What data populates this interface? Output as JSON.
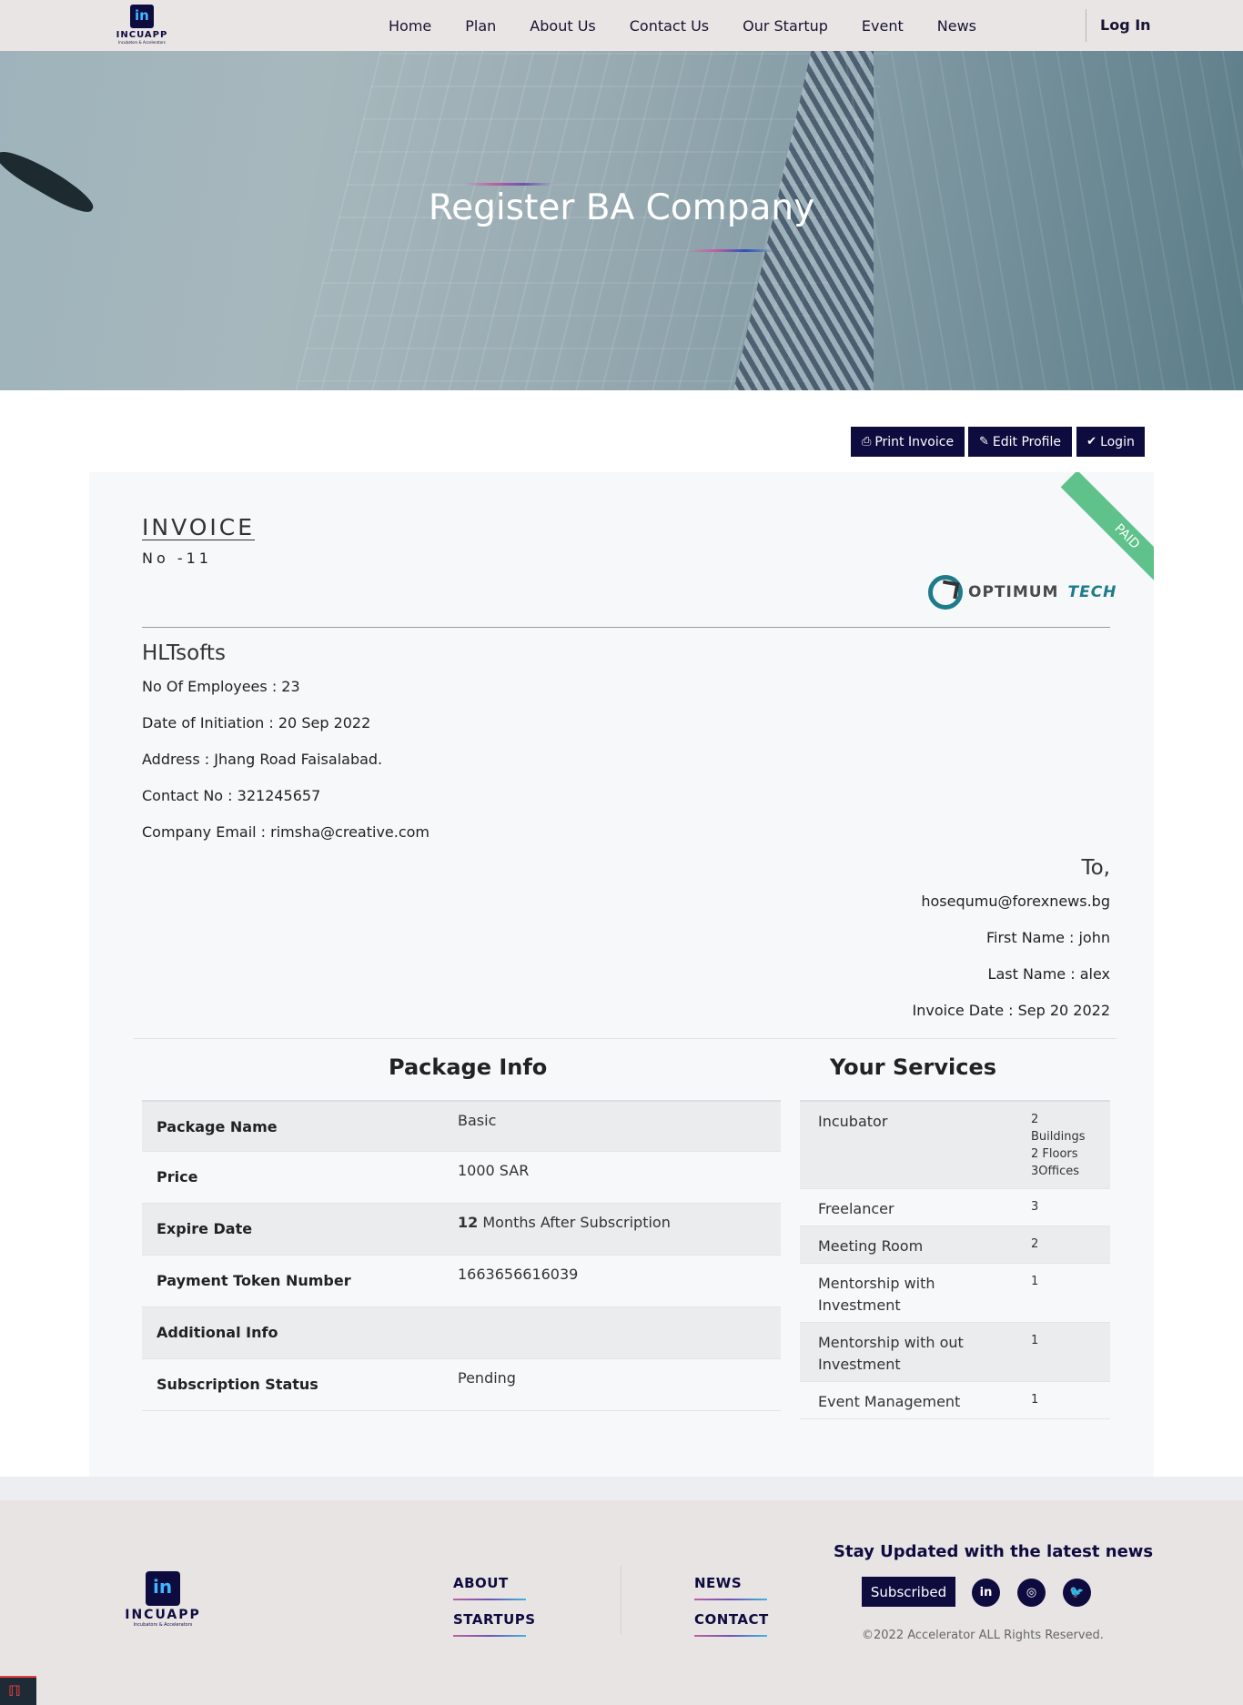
{
  "nav": {
    "logo_word": "INCUAPP",
    "logo_tagline": "Incubators & Accelerators",
    "links": [
      "Home",
      "Plan",
      "About Us",
      "Contact Us",
      "Our Startup",
      "Event",
      "News"
    ],
    "login": "Log In"
  },
  "hero": {
    "title": "Register BA Company"
  },
  "actions": {
    "print": "Print Invoice",
    "edit": "Edit Profile",
    "login": "Login"
  },
  "invoice": {
    "ribbon": "PAID",
    "title": "INVOICE",
    "number": "No -11",
    "brand_word1": "OPTIMUM",
    "brand_word2": "TECH",
    "company_name": "HLTsofts",
    "employees": "No Of Employees : 23",
    "initiation": "Date of Initiation : 20 Sep 2022",
    "address": "Address : Jhang Road Faisalabad.",
    "contact": "Contact No : 321245657",
    "email": "Company Email : rimsha@creative.com",
    "to_label": "To,",
    "to_email": "hosequmu@forexnews.bg",
    "first_name": "First Name : john",
    "last_name": "Last Name : alex",
    "invoice_date": "Invoice Date : Sep 20 2022"
  },
  "package": {
    "title": "Package Info",
    "rows": [
      {
        "label": "Package Name",
        "value": "Basic"
      },
      {
        "label": "Price",
        "value": "1000 SAR"
      },
      {
        "label": "Expire Date",
        "value_bold": "12",
        "value": " Months After Subscription"
      },
      {
        "label": "Payment Token Number",
        "value": "1663656616039"
      },
      {
        "label": "Additional Info",
        "value": ""
      },
      {
        "label": "Subscription Status",
        "value": "Pending"
      }
    ]
  },
  "services": {
    "title": "Your Services",
    "rows": [
      {
        "label": "Incubator",
        "value": "2 Buildings 2 Floors 3Offices"
      },
      {
        "label": "Freelancer",
        "value": "3"
      },
      {
        "label": "Meeting Room",
        "value": "2"
      },
      {
        "label": "Mentorship with Investment",
        "value": "1"
      },
      {
        "label": "Mentorship with out Investment",
        "value": "1"
      },
      {
        "label": "Event Management",
        "value": "1"
      }
    ]
  },
  "footer": {
    "logo_word": "INCUAPP",
    "logo_tagline": "Incubators & Accelerators",
    "links": [
      "ABOUT",
      "STARTUPS",
      "NEWS",
      "CONTACT"
    ],
    "news_title": "Stay Updated with the latest news",
    "subscribe": "Subscribed",
    "social": [
      "in",
      "◎",
      "🐦"
    ],
    "copyright": "©2022 Accelerator ALL Rights Reserved."
  },
  "icons": {
    "printer": "printer-icon",
    "edit": "edit-icon",
    "check": "check-icon",
    "linkedin": "linkedin-icon",
    "instagram": "instagram-icon",
    "twitter": "twitter-icon"
  },
  "colors": {
    "brand_navy": "#0e0b3f",
    "paid_green": "#5fc28a",
    "teal": "#1e7b8a"
  }
}
